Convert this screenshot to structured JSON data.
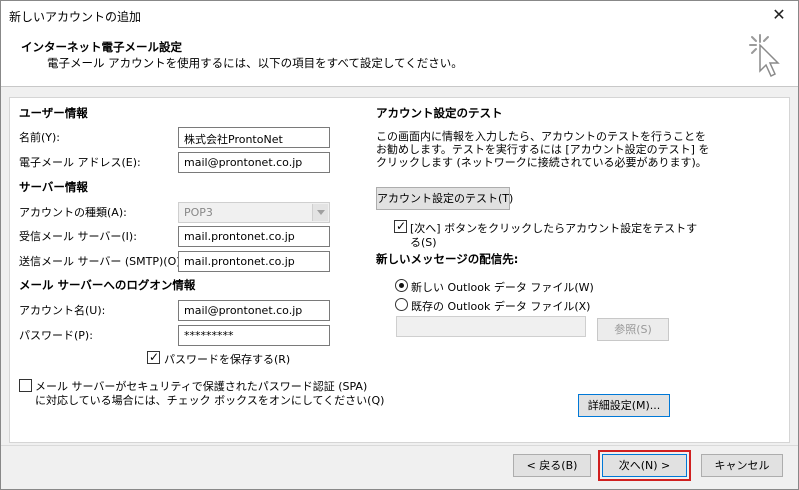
{
  "window": {
    "title": "新しいアカウントの追加",
    "close_glyph": "✕"
  },
  "header": {
    "title": "インターネット電子メール設定",
    "subtitle": "電子メール アカウントを使用するには、以下の項目をすべて設定してください。"
  },
  "left": {
    "user_section": "ユーザー情報",
    "name_label": "名前(Y):",
    "name_value": "株式会社ProntoNet",
    "email_label": "電子メール アドレス(E):",
    "email_value": "mail@prontonet.co.jp",
    "server_section": "サーバー情報",
    "account_type_label": "アカウントの種類(A):",
    "account_type_value": "POP3",
    "incoming_label": "受信メール サーバー(I):",
    "incoming_value": "mail.prontonet.co.jp",
    "outgoing_label": "送信メール サーバー (SMTP)(O):",
    "outgoing_value": "mail.prontonet.co.jp",
    "logon_section": "メール サーバーへのログオン情報",
    "account_name_label": "アカウント名(U):",
    "account_name_value": "mail@prontonet.co.jp",
    "password_label": "パスワード(P):",
    "password_value": "*********",
    "save_password_label": "パスワードを保存する(R)",
    "spa_label_line1": "メール サーバーがセキュリティで保護されたパスワード認証 (SPA)",
    "spa_label_line2": "に対応している場合には、チェック ボックスをオンにしてください(Q)"
  },
  "right": {
    "test_section": "アカウント設定のテスト",
    "test_desc_line1": "この画面内に情報を入力したら、アカウントのテストを行うことを",
    "test_desc_line2": "お勧めします。テストを実行するには [アカウント設定のテスト] を",
    "test_desc_line3": "クリックします (ネットワークに接続されている必要があります)。",
    "test_button": "アカウント設定のテスト(T)",
    "auto_test_line1": "[次へ] ボタンをクリックしたらアカウント設定をテストす",
    "auto_test_line2": "る(S)",
    "delivery_section": "新しいメッセージの配信先:",
    "radio_new": "新しい Outlook データ ファイル(W)",
    "radio_existing": "既存の Outlook データ ファイル(X)",
    "browse_button": "参照(S)",
    "more_settings_button": "詳細設定(M)..."
  },
  "footer": {
    "back_button": "< 戻る(B)",
    "next_button": "次へ(N) >",
    "cancel_button": "キャンセル"
  }
}
